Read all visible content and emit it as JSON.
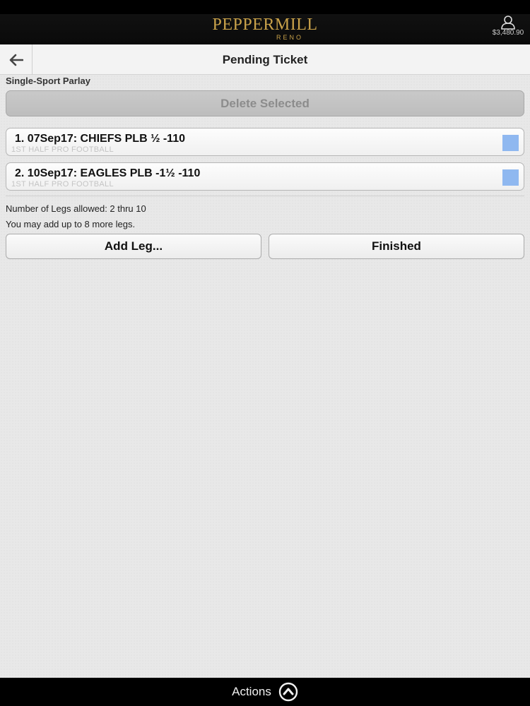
{
  "header": {
    "logo_main": "PEPPERMILL",
    "logo_sub": "RENO",
    "balance": "$3,480.90"
  },
  "nav": {
    "title": "Pending Ticket"
  },
  "ticket": {
    "type_label": "Single-Sport Parlay",
    "delete_label": "Delete Selected",
    "legs": [
      {
        "title": "1. 07Sep17: CHIEFS PLB ½ -110",
        "subtitle": "1ST HALF PRO FOOTBALL",
        "selected": true
      },
      {
        "title": "2. 10Sep17: EAGLES PLB -1½ -110",
        "subtitle": "1ST HALF PRO FOOTBALL",
        "selected": true
      }
    ],
    "legs_allowed": "Number of Legs allowed:  2 thru 10",
    "legs_remaining": "You may add up to 8 more legs.",
    "add_leg_label": "Add Leg...",
    "finished_label": "Finished"
  },
  "footer": {
    "actions_label": "Actions"
  },
  "colors": {
    "brand_gold": "#c9a24a",
    "checkbox_selected": "#8fb8f0"
  }
}
